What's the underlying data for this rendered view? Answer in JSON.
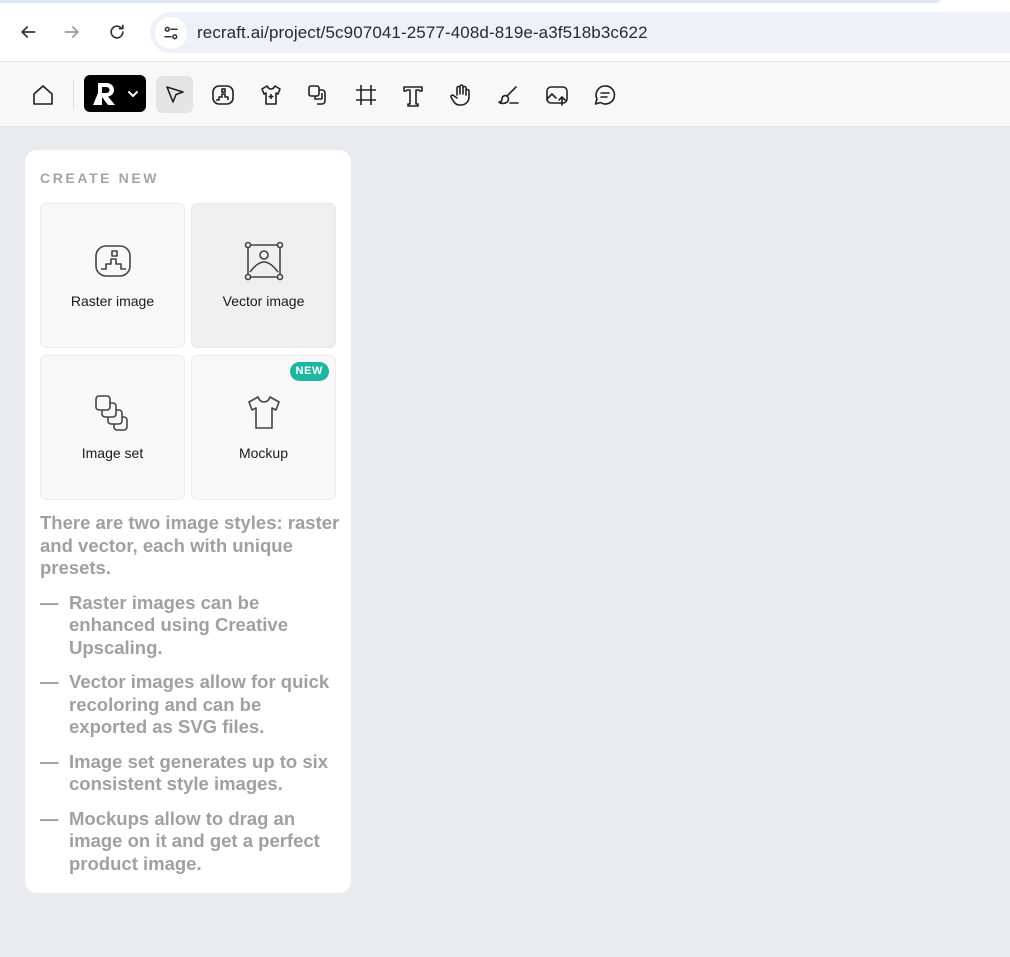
{
  "browser": {
    "url": "recraft.ai/project/5c907041-2577-408d-819e-a3f518b3c622"
  },
  "toolbar": {
    "tools": [
      {
        "name": "home-icon"
      },
      {
        "name": "select-icon"
      },
      {
        "name": "raster-image-icon"
      },
      {
        "name": "mockup-icon"
      },
      {
        "name": "image-set-icon"
      },
      {
        "name": "frame-icon"
      },
      {
        "name": "text-icon"
      },
      {
        "name": "hand-icon"
      },
      {
        "name": "brush-icon"
      },
      {
        "name": "upload-image-icon"
      },
      {
        "name": "comment-icon"
      }
    ]
  },
  "panel": {
    "title": "CREATE NEW",
    "cards": {
      "raster": {
        "label": "Raster image"
      },
      "vector": {
        "label": "Vector image"
      },
      "image_set": {
        "label": "Image set"
      },
      "mockup": {
        "label": "Mockup",
        "badge": "NEW"
      }
    },
    "intro": "There are two image styles: raster and vector, each with unique presets.",
    "bullet_dash": "—",
    "bullets": [
      "Raster images can be enhanced using Creative Upscaling.",
      "Vector images allow for quick recoloring and can be exported as SVG files.",
      "Image set generates up to six consistent style images.",
      "Mockups allow to drag an image on it and get a perfect product image."
    ]
  },
  "colors": {
    "accent_new": "#1fb5a0",
    "canvas": "#e9eaed",
    "muted_text": "#a0a0a0"
  }
}
